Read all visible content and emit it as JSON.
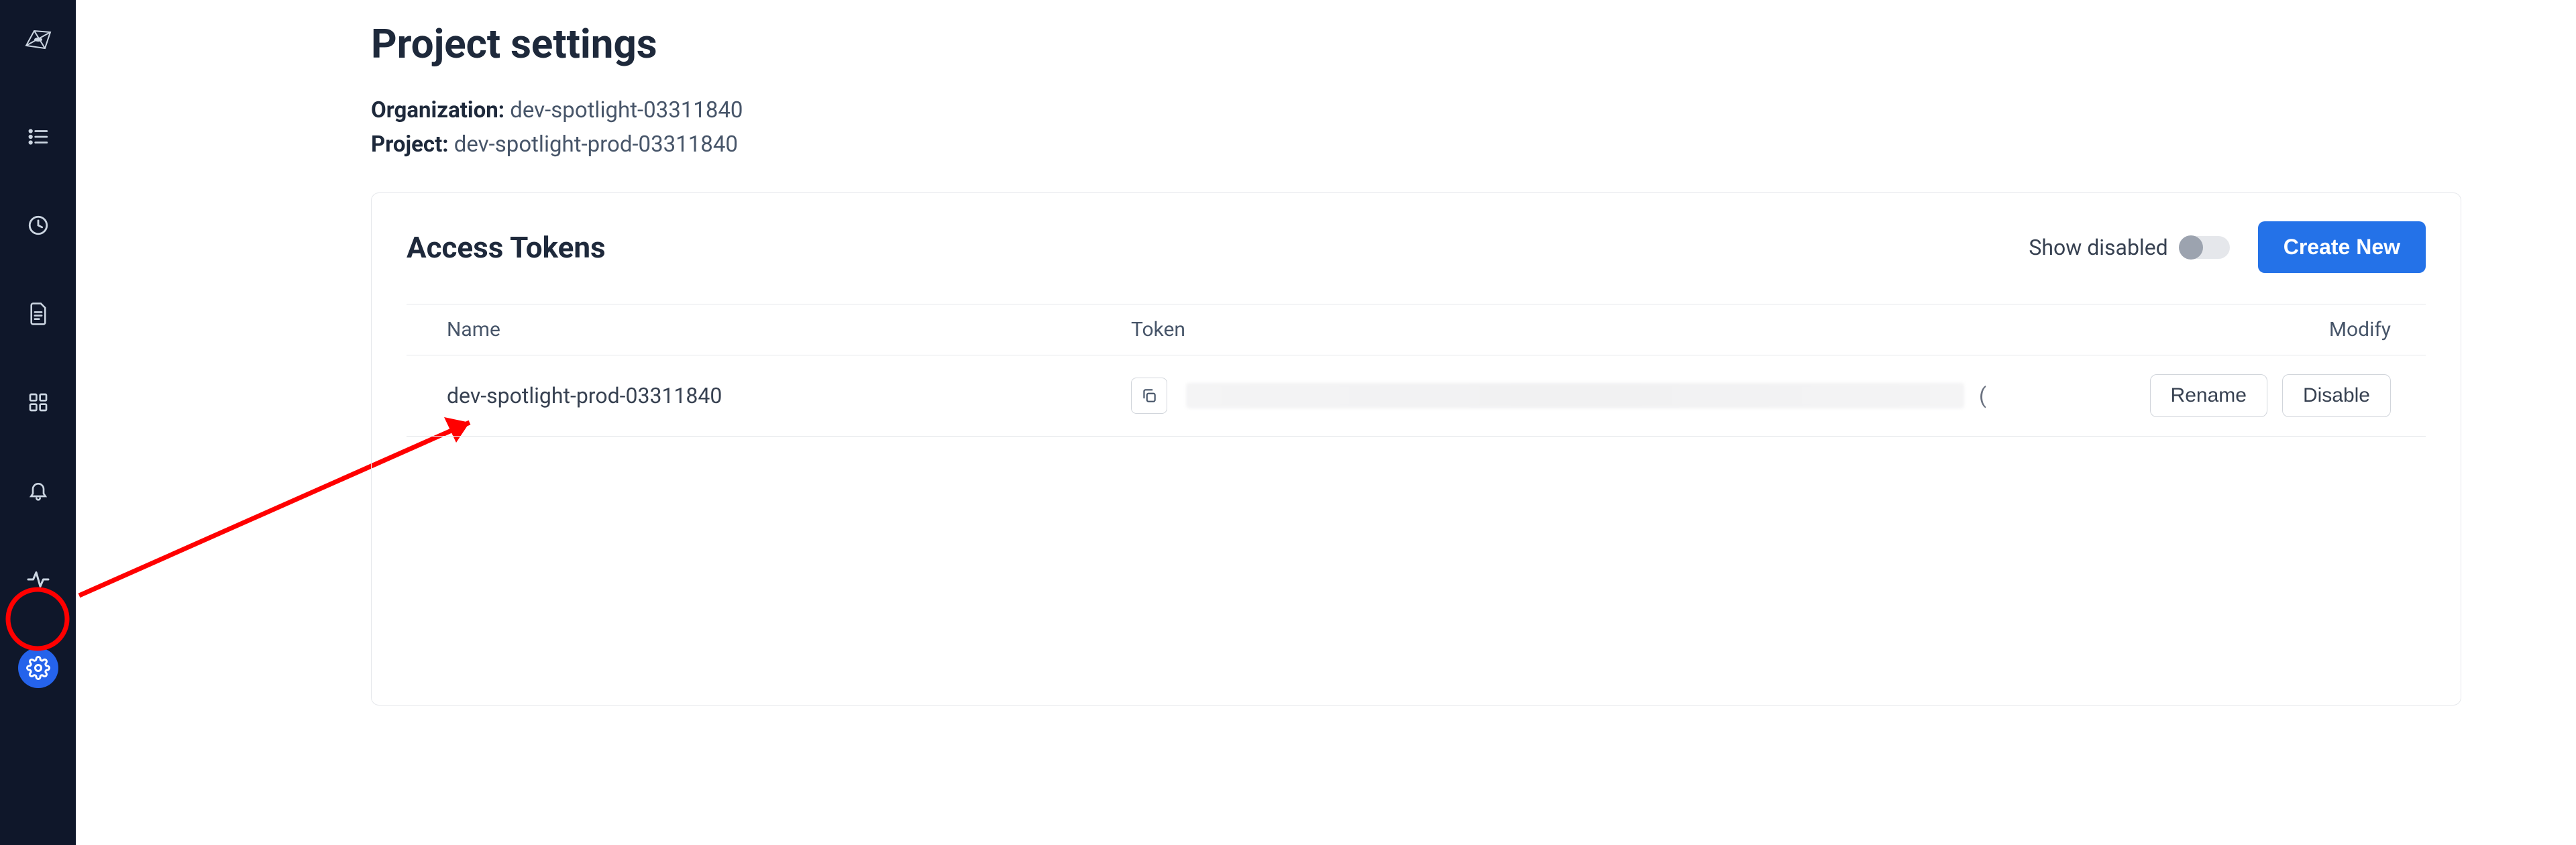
{
  "sidebar": {
    "items": [
      {
        "id": "logo",
        "name": "logo-icon",
        "active": false
      },
      {
        "id": "list",
        "name": "list-icon",
        "active": false
      },
      {
        "id": "clock",
        "name": "clock-icon",
        "active": false
      },
      {
        "id": "document",
        "name": "document-icon",
        "active": false
      },
      {
        "id": "grid",
        "name": "grid-icon",
        "active": false
      },
      {
        "id": "bell",
        "name": "bell-icon",
        "active": false
      },
      {
        "id": "activity",
        "name": "activity-icon",
        "active": false
      },
      {
        "id": "settings",
        "name": "gear-icon",
        "active": true
      }
    ]
  },
  "page": {
    "title": "Project settings",
    "org_label": "Organization:",
    "org_value": "dev-spotlight-03311840",
    "project_label": "Project:",
    "project_value": "dev-spotlight-prod-03311840"
  },
  "tokens_card": {
    "title": "Access Tokens",
    "show_disabled_label": "Show disabled",
    "show_disabled_on": false,
    "create_label": "Create New",
    "columns": {
      "name": "Name",
      "token": "Token",
      "modify": "Modify"
    },
    "rows": [
      {
        "name": "dev-spotlight-prod-03311840",
        "token_obscured": true,
        "token_tail": "(",
        "rename_label": "Rename",
        "disable_label": "Disable"
      }
    ]
  },
  "annotation": {
    "type": "arrow-to-sidebar-settings",
    "color": "#ff0000"
  },
  "colors": {
    "sidebar_bg": "#0f172a",
    "accent": "#2472e8",
    "border": "#e5e7eb",
    "text": "#1e293b"
  }
}
